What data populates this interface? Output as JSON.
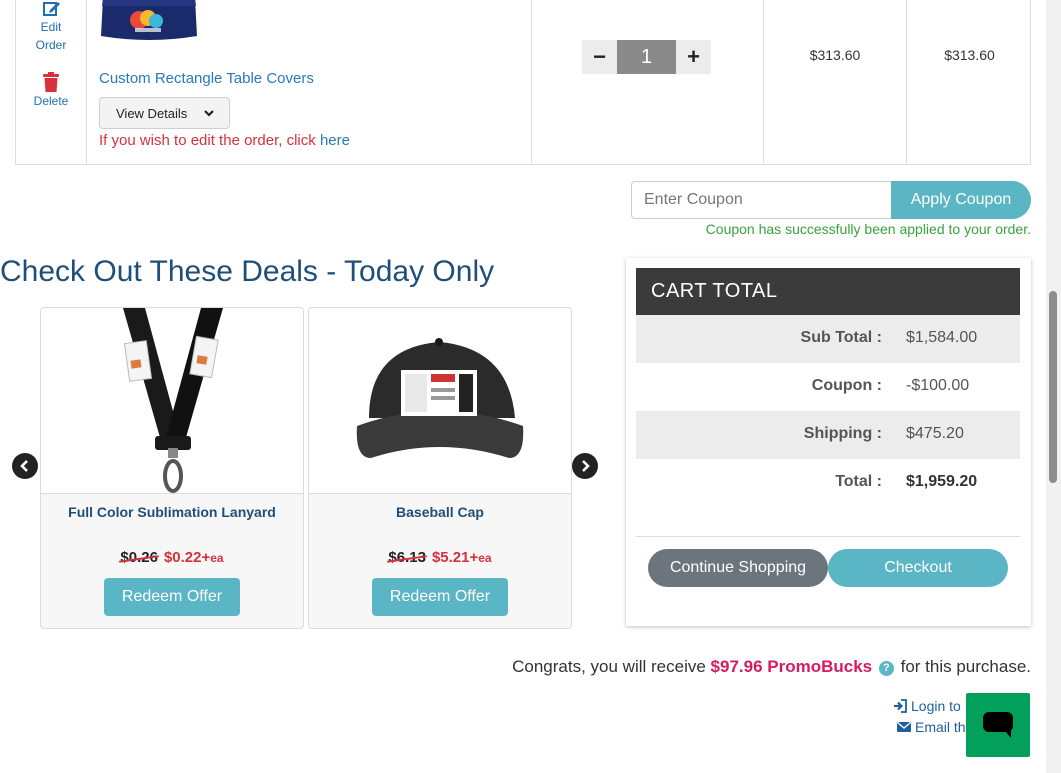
{
  "cart_item": {
    "edit_label_line1": "Edit",
    "edit_label_line2": "Order",
    "delete_label": "Delete",
    "product_name": "Custom Rectangle Table Covers",
    "view_details_label": "View Details",
    "edit_note_prefix": "If you wish to edit the order, click ",
    "edit_note_link": "here",
    "quantity": "1",
    "minus": "−",
    "plus": "+",
    "unit_price": "$313.60",
    "line_total": "$313.60"
  },
  "coupon": {
    "placeholder": "Enter Coupon",
    "apply_label": "Apply Coupon",
    "success_message": "Coupon has successfully been applied to your order."
  },
  "deals": {
    "title": "Check Out These Deals - Today Only",
    "items": [
      {
        "name": "Full Color Sublimation Lanyard",
        "old_price": "$0.26",
        "new_price": "$0.22+",
        "unit": "ea",
        "button": "Redeem Offer"
      },
      {
        "name": "Baseball Cap",
        "old_price": "$6.13",
        "new_price": "$5.21+",
        "unit": "ea",
        "button": "Redeem Offer"
      }
    ]
  },
  "cart_total": {
    "header": "CART  TOTAL",
    "rows": [
      {
        "label": "Sub Total :",
        "value": "$1,584.00"
      },
      {
        "label": "Coupon :",
        "value": "-$100.00"
      },
      {
        "label": "Shipping :",
        "value": "$475.20"
      },
      {
        "label": "Total :",
        "value": "$1,959.20"
      }
    ],
    "continue_label": "Continue Shopping",
    "checkout_label": "Checkout"
  },
  "footer": {
    "congrats_prefix": "Congrats, you will receive ",
    "promobucks": "$97.96 PromoBucks",
    "congrats_suffix": " for this purchase.",
    "login_link": "Login to",
    "email_link": "Email th"
  },
  "colors": {
    "accent_teal": "#5ab5c4",
    "title_blue": "#1f4e79",
    "link_blue": "#2a7ab8",
    "alert_red": "#d6313d",
    "promo_pink": "#d81b60",
    "success_green": "#3aa33a",
    "chat_green": "#02a05a",
    "header_dark": "#3b3b3b"
  },
  "icons": [
    "edit-icon",
    "trash-icon",
    "chevron-down-icon",
    "arrow-left-icon",
    "arrow-right-icon",
    "question-circle-icon",
    "sign-in-icon",
    "envelope-icon",
    "chat-icon"
  ]
}
